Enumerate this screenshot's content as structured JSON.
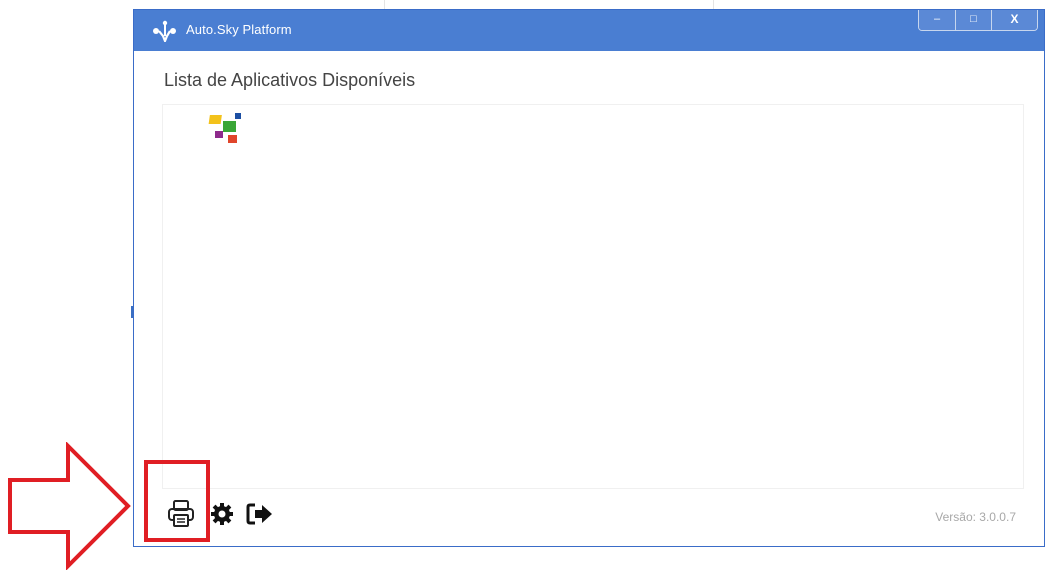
{
  "window": {
    "title": "Auto.Sky Platform",
    "controls": {
      "minimize": "–",
      "maximize": "□",
      "close": "X"
    }
  },
  "main": {
    "heading": "Lista de Aplicativos Disponíveis"
  },
  "footer": {
    "icons": [
      "printer-icon",
      "settings-icon",
      "logout-icon"
    ],
    "version": "Versão: 3.0.0.7"
  },
  "colors": {
    "titlebar": "#4a7ed2",
    "annotation": "#e01e24"
  }
}
